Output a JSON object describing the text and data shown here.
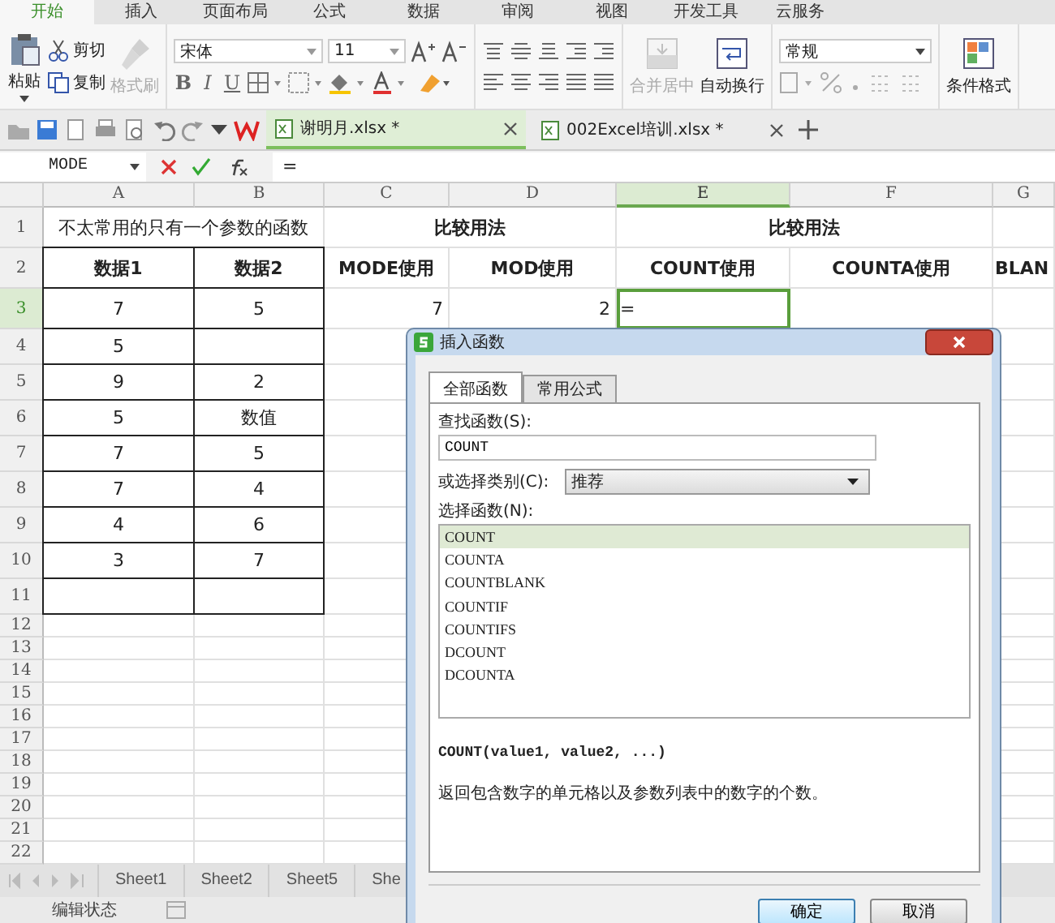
{
  "ribbon_tabs": [
    {
      "label": "开始",
      "selected": true
    },
    {
      "label": "插入",
      "selected": false
    },
    {
      "label": "页面布局",
      "selected": false
    },
    {
      "label": "公式",
      "selected": false
    },
    {
      "label": "数据",
      "selected": false
    },
    {
      "label": "审阅",
      "selected": false
    },
    {
      "label": "视图",
      "selected": false
    },
    {
      "label": "开发工具",
      "selected": false
    },
    {
      "label": "云服务",
      "selected": false
    }
  ],
  "ribbon": {
    "paste": "粘贴",
    "cut": "剪切",
    "copy": "复制",
    "format_painter": {
      "label": "格式刷",
      "disabled": true
    },
    "font_name": "宋体",
    "font_size": "11",
    "font_styles": [
      "B",
      "I",
      "U"
    ],
    "merge": {
      "label": "合并居中",
      "disabled": true
    },
    "wrap": {
      "label": "自动换行",
      "disabled": false
    },
    "number_format": "常规",
    "conditional_format": "条件格式"
  },
  "doc_tabs": [
    {
      "label": "谢明月.xlsx *",
      "selected": true
    },
    {
      "label": "002Excel培训.xlsx *",
      "selected": false
    }
  ],
  "formula_bar": {
    "name_box": "MODE",
    "formula": "="
  },
  "sheet": {
    "columns": [
      {
        "label": "A",
        "selected": false
      },
      {
        "label": "B",
        "selected": false
      },
      {
        "label": "C",
        "selected": false
      },
      {
        "label": "D",
        "selected": false
      },
      {
        "label": "E",
        "selected": true
      },
      {
        "label": "F",
        "selected": false
      },
      {
        "label": "G",
        "selected": false
      }
    ],
    "rows": [
      {
        "header": "1",
        "selected": false,
        "cells": [
          {
            "text": "不太常用的只有一个参数的函数",
            "merged": true
          },
          {
            "text": "比较用法",
            "merged": true,
            "bold": true
          },
          {
            "text": "比较用法",
            "merged": true,
            "bold": true
          }
        ]
      },
      {
        "header": "2",
        "selected": false,
        "cells": [
          {
            "text": "数据1",
            "bold": true,
            "bordered": true
          },
          {
            "text": "数据2",
            "bold": true,
            "bordered": true
          },
          {
            "text": "MODE使用",
            "bold": true
          },
          {
            "text": "MOD使用",
            "bold": true
          },
          {
            "text": "COUNT使用",
            "bold": true
          },
          {
            "text": "COUNTA使用",
            "bold": true
          },
          {
            "text": "BLAN",
            "bold": true
          }
        ]
      },
      {
        "header": "3",
        "selected": true,
        "cells": [
          {
            "text": "7",
            "bordered": true
          },
          {
            "text": "5",
            "bordered": true
          },
          {
            "text": "7",
            "kind": "number"
          },
          {
            "text": "2",
            "kind": "number"
          },
          {
            "text": "=",
            "kind": "formula"
          }
        ]
      },
      {
        "header": "4",
        "selected": false,
        "cells": [
          {
            "text": "5",
            "bordered": true
          },
          {
            "bordered": true
          }
        ]
      },
      {
        "header": "5",
        "selected": false,
        "cells": [
          {
            "text": "9",
            "bordered": true
          },
          {
            "text": "2",
            "bordered": true
          }
        ]
      },
      {
        "header": "6",
        "selected": false,
        "cells": [
          {
            "text": "5",
            "bordered": true
          },
          {
            "text": "数值",
            "bordered": true
          }
        ]
      },
      {
        "header": "7",
        "selected": false,
        "cells": [
          {
            "text": "7",
            "bordered": true
          },
          {
            "text": "5",
            "bordered": true
          }
        ]
      },
      {
        "header": "8",
        "selected": false,
        "cells": [
          {
            "text": "7",
            "bordered": true
          },
          {
            "text": "4",
            "bordered": true
          }
        ]
      },
      {
        "header": "9",
        "selected": false,
        "cells": [
          {
            "text": "4",
            "bordered": true
          },
          {
            "text": "6",
            "bordered": true
          }
        ]
      },
      {
        "header": "10",
        "selected": false,
        "cells": [
          {
            "text": "3",
            "bordered": true
          },
          {
            "text": "7",
            "bordered": true
          }
        ]
      },
      {
        "header": "11",
        "selected": false,
        "cells": [
          {
            "bordered": true
          },
          {
            "bordered": true
          }
        ]
      },
      {
        "header": "12",
        "selected": false,
        "cells": []
      },
      {
        "header": "13",
        "selected": false,
        "cells": []
      },
      {
        "header": "14",
        "selected": false,
        "cells": []
      },
      {
        "header": "15",
        "selected": false,
        "cells": []
      },
      {
        "header": "16",
        "selected": false,
        "cells": []
      },
      {
        "header": "17",
        "selected": false,
        "cells": []
      },
      {
        "header": "18",
        "selected": false,
        "cells": []
      },
      {
        "header": "19",
        "selected": false,
        "cells": []
      },
      {
        "header": "20",
        "selected": false,
        "cells": []
      },
      {
        "header": "21",
        "selected": false,
        "cells": []
      },
      {
        "header": "22",
        "selected": false,
        "cells": []
      }
    ]
  },
  "sheet_tabs": [
    "Sheet1",
    "Sheet2",
    "Sheet5",
    "She"
  ],
  "status_bar": {
    "text": "编辑状态"
  },
  "dialog": {
    "title": "插入函数",
    "tabs": [
      {
        "label": "全部函数",
        "selected": true
      },
      {
        "label": "常用公式",
        "selected": false
      }
    ],
    "search_label": "查找函数(S):",
    "search_value": "COUNT",
    "category_label": "或选择类别(C):",
    "category_value": "推荐",
    "list_label": "选择函数(N):",
    "functions": [
      {
        "name": "COUNT",
        "selected": true
      },
      {
        "name": "COUNTA",
        "selected": false
      },
      {
        "name": "COUNTBLANK",
        "selected": false
      },
      {
        "name": "COUNTIF",
        "selected": false
      },
      {
        "name": "COUNTIFS",
        "selected": false
      },
      {
        "name": "DCOUNT",
        "selected": false
      },
      {
        "name": "DCOUNTA",
        "selected": false
      }
    ],
    "signature": "COUNT(value1, value2, ...)",
    "description": "返回包含数字的单元格以及参数列表中的数字的个数。",
    "buttons": [
      {
        "label": "确定",
        "kind": "primary"
      },
      {
        "label": "取消",
        "kind": "secondary"
      }
    ]
  }
}
